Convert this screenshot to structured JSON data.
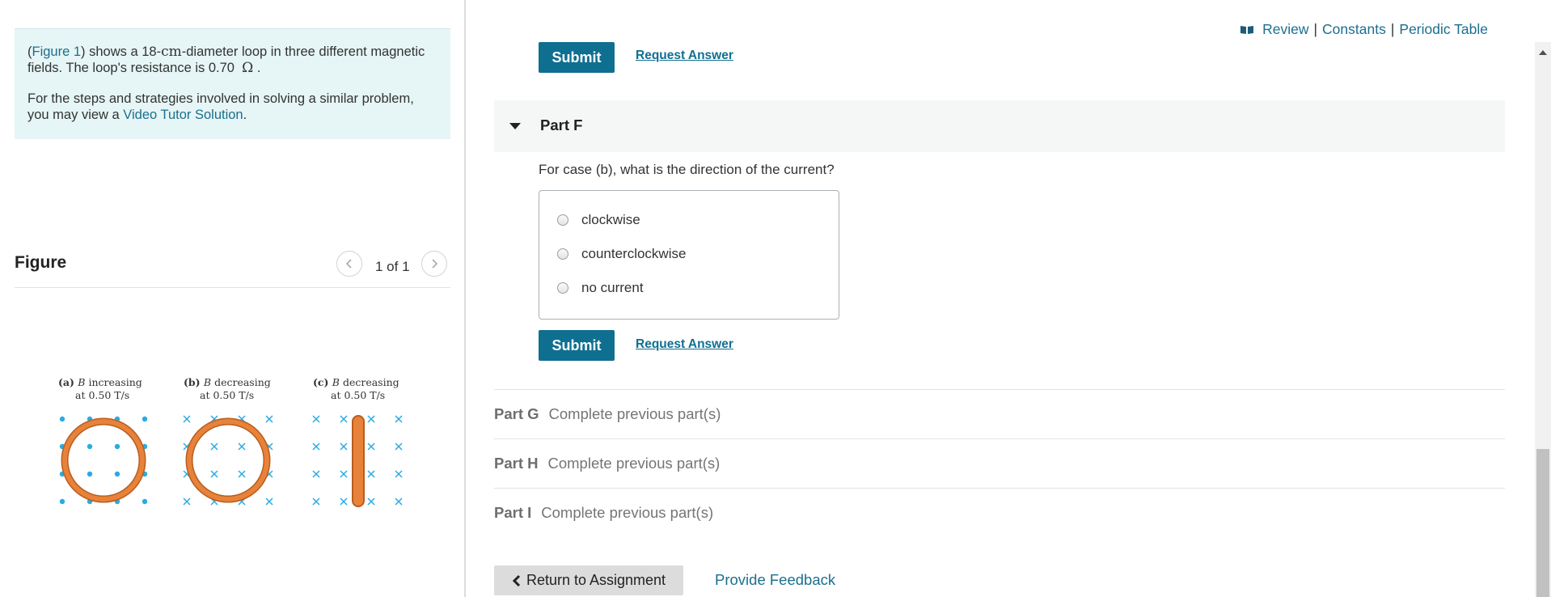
{
  "problem": {
    "figure_link": "Figure 1",
    "text_a": ") shows a 18-",
    "unit_cm": "cm",
    "text_b": "-diameter loop in three different magnetic fields. The loop's resistance is 0.70",
    "omega": "Ω",
    "text_c": ".",
    "p2_a": "For the steps and strategies involved in solving a similar problem, you may view a ",
    "video_link": "Video Tutor Solution",
    "p2_b": "."
  },
  "figure": {
    "title": "Figure",
    "page_count": "1 of 1",
    "panels": [
      {
        "label_a": "(a) ",
        "label_b": "B",
        "label_c": " increasing",
        "label_d": "at 0.50 T/s"
      },
      {
        "label_a": "(b) ",
        "label_b": "B",
        "label_c": " decreasing",
        "label_d": "at 0.50 T/s"
      },
      {
        "label_a": "(c) ",
        "label_b": "B",
        "label_c": " decreasing",
        "label_d": "at 0.50 T/s"
      }
    ]
  },
  "top_links": {
    "review": "Review",
    "sep1": "|",
    "constants": "Constants",
    "sep2": "|",
    "periodic": "Periodic Table"
  },
  "top_submit": {
    "submit": "Submit",
    "request": "Request Answer"
  },
  "part_f": {
    "label": "Part F",
    "question": "For case (b), what is the direction of the current?",
    "choices": [
      "clockwise",
      "counterclockwise",
      "no current"
    ],
    "submit": "Submit",
    "request": "Request Answer"
  },
  "locked_parts": [
    {
      "name": "Part G",
      "status": "Complete previous part(s)"
    },
    {
      "name": "Part H",
      "status": "Complete previous part(s)"
    },
    {
      "name": "Part I",
      "status": "Complete previous part(s)"
    }
  ],
  "footer": {
    "return_label": "Return to Assignment",
    "feedback": "Provide Feedback"
  },
  "colors": {
    "accent": "#0f6f91",
    "link": "#1b6f8e",
    "problem_bg": "#e6f5f5",
    "loop_orange": "#e8823a",
    "field_blue": "#29abe2"
  }
}
